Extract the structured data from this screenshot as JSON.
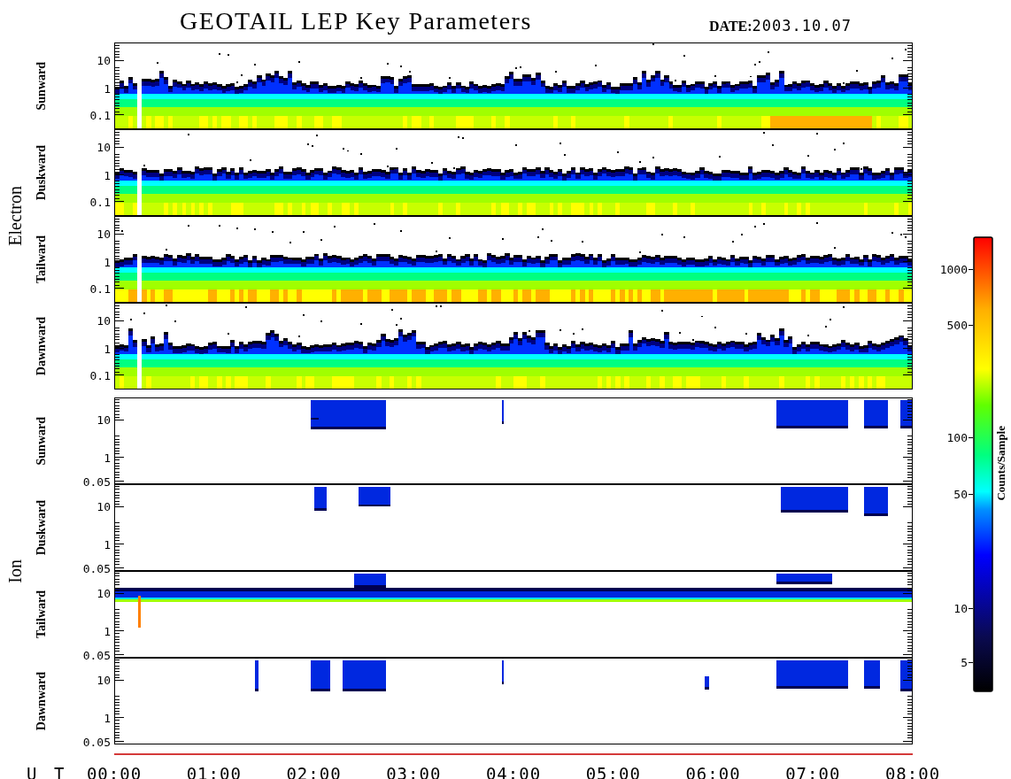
{
  "title": "GEOTAIL LEP Key Parameters",
  "date": {
    "label": "DATE:",
    "value": "2003.10.07"
  },
  "groups": [
    {
      "name": "Electron",
      "kind": "electron",
      "panels": [
        {
          "label": "Sunward",
          "yticks": [
            "10",
            "1",
            "0.1"
          ]
        },
        {
          "label": "Duskward",
          "yticks": [
            "10",
            "1",
            "0.1"
          ]
        },
        {
          "label": "Tailward",
          "yticks": [
            "10",
            "1",
            "0.1"
          ]
        },
        {
          "label": "Dawnward",
          "yticks": [
            "10",
            "1",
            "0.1"
          ]
        }
      ]
    },
    {
      "name": "Ion",
      "kind": "ion",
      "panels": [
        {
          "label": "Sunward",
          "yticks": [
            "10",
            "1",
            "0.05"
          ]
        },
        {
          "label": "Duskward",
          "yticks": [
            "10",
            "1",
            "0.05"
          ]
        },
        {
          "label": "Tailward",
          "yticks": [
            "10",
            "1",
            "0.05"
          ]
        },
        {
          "label": "Dawnward",
          "yticks": [
            "10",
            "1",
            "0.05"
          ]
        }
      ]
    }
  ],
  "x_axis": {
    "label": "U T",
    "ticks": [
      "00:00",
      "01:00",
      "02:00",
      "03:00",
      "04:00",
      "05:00",
      "06:00",
      "07:00",
      "08:00"
    ]
  },
  "color_scale": {
    "label": "Counts/Sample",
    "ticks": [
      "1000",
      "500",
      "100",
      "50",
      "10",
      "5"
    ]
  }
}
